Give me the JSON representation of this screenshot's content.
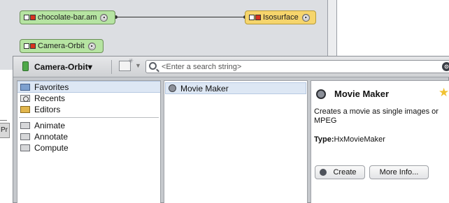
{
  "pool": {
    "nodes": {
      "chocolate": "chocolate-bar.am",
      "isosurface": "Isosurface",
      "camera": "Camera-Orbit"
    },
    "side_tab_label": "Pr",
    "port_glyph": "⦿"
  },
  "popup": {
    "module_selector": "Camera-Orbit",
    "module_selector_arrow": "▾",
    "search": {
      "placeholder": "<Enter a search string>",
      "value": ""
    },
    "categories": [
      {
        "label": "Favorites",
        "icon": "favorites-folder-icon",
        "selected": true
      },
      {
        "label": "Recents",
        "icon": "recents-clock-icon",
        "selected": false
      },
      {
        "label": "Editors",
        "icon": "editors-folder-icon",
        "selected": false
      },
      {
        "label": "Animate",
        "icon": "folder-icon",
        "selected": false
      },
      {
        "label": "Annotate",
        "icon": "folder-icon",
        "selected": false
      },
      {
        "label": "Compute",
        "icon": "folder-icon",
        "selected": false
      }
    ],
    "modules": [
      {
        "label": "Movie Maker",
        "icon": "movie-maker-icon",
        "selected": true
      }
    ],
    "info": {
      "title": "Movie Maker",
      "description": "Creates a movie as single images or MPEG",
      "type_label": "Type:",
      "type_value": "HxMovieMaker",
      "create_label": "Create",
      "more_info_label": "More Info..."
    }
  },
  "colors": {
    "node_green": "#b6e4a2",
    "node_yellow": "#f6d56c",
    "selection": "#dde7f4",
    "favorite_star": "#f1c232"
  }
}
